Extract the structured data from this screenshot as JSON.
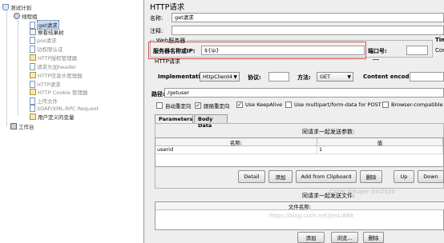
{
  "tree": {
    "items": [
      {
        "label": "测试计划",
        "icon": "test-plan-icon"
      },
      {
        "label": "线程组",
        "icon": "thread-group-icon"
      },
      {
        "label": "get请求",
        "icon": "sampler-icon"
      },
      {
        "label": "察看结果树",
        "icon": "listener-icon"
      },
      {
        "label": "pos请求",
        "icon": "sampler-icon"
      },
      {
        "label": "功权限认证",
        "icon": "sampler-icon"
      },
      {
        "label": "HTTP授权管理器",
        "icon": "config-icon"
      },
      {
        "label": "请求头加header",
        "icon": "sampler-icon"
      },
      {
        "label": "HTTP信息头管理器",
        "icon": "config-icon"
      },
      {
        "label": "HTTP请求",
        "icon": "sampler-icon"
      },
      {
        "label": "HTTP Cookie 管理器",
        "icon": "config-icon"
      },
      {
        "label": "上传文件",
        "icon": "sampler-icon"
      },
      {
        "label": "SOAP/XML-RPC Request",
        "icon": "sampler-icon"
      },
      {
        "label": "用户定义的变量",
        "icon": "config-icon"
      },
      {
        "label": "工作台",
        "icon": "workbench-icon"
      }
    ]
  },
  "panel": {
    "title": "HTTP请求",
    "name_label": "名称:",
    "name_value": "get请求",
    "comment_label": "注释:",
    "comment_value": "",
    "web_server_label": "Web服务器",
    "server_label": "服务器名称或IP:",
    "server_value": "${ip}",
    "port_label": "端口号:",
    "port_value": "",
    "timeout_label": "Tim",
    "connect_label": "Con",
    "http_request_label": "HTTP请求",
    "impl_label": "Implementation:",
    "impl_value": "HttpClient4",
    "protocol_label": "协议:",
    "protocol_value": "",
    "method_label": "方法:",
    "method_value": "GET",
    "encoding_label": "Content encoding:",
    "encoding_value": "",
    "path_label": "路径:",
    "path_value": "/getuser",
    "checkboxes": [
      {
        "label": "自动重定向",
        "checked": false
      },
      {
        "label": "跟随重定向",
        "checked": true
      },
      {
        "label": "Use KeepAlive",
        "checked": true
      },
      {
        "label": "Use multipart/form-data for POST",
        "checked": false
      },
      {
        "label": "Browser-compatible h",
        "checked": false
      }
    ],
    "tabs": [
      {
        "label": "Parameters",
        "active": true
      },
      {
        "label": "Body Data",
        "active": false
      }
    ],
    "params_caption": "同请求一起发送参数:",
    "params_headers": [
      "名称:",
      "值"
    ],
    "params_rows": [
      {
        "name": "userid",
        "value": "1"
      }
    ],
    "param_buttons": [
      "Detail",
      "添加",
      "Add from Clipboard",
      "删除",
      "Up",
      "Down"
    ],
    "files_caption": "同请求一起发送文件:",
    "files_header": "文件名称:",
    "bottom_buttons": [
      "添加",
      "浏览...",
      "删除"
    ],
    "watermark": "CSDN @Super Girl2020",
    "watermark_url": "https://blog.csdn.net/JenLi888"
  }
}
